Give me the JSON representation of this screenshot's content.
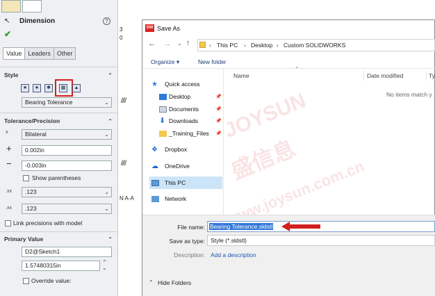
{
  "property_manager": {
    "title": "Dimension",
    "help_glyph": "?",
    "check_glyph": "✔",
    "tabs": [
      "Value",
      "Leaders",
      "Other"
    ],
    "style": {
      "header": "Style",
      "selected": "Bearing Tolerance"
    },
    "tolerance": {
      "header": "Tolerance/Precision",
      "type": "Bilateral",
      "plus_value": "0.002in",
      "minus_value": "-0.003in",
      "show_parentheses": "Show parentheses",
      "precision1": ".123",
      "precision2": ".123",
      "link_precisions": "Link precisions with model"
    },
    "primary_value": {
      "header": "Primary Value",
      "name": "D2@Sketch1",
      "value": "1.57480315in",
      "override": "Override value:"
    }
  },
  "drawing": {
    "label_a": "3",
    "label_b": "0",
    "section_label": "N A-A"
  },
  "dialog": {
    "title": "Save As",
    "app_icon_text": "SW",
    "breadcrumb": [
      "This PC",
      "Desktop",
      "Custom SOLIDWORKS"
    ],
    "toolbar": {
      "organize": "Organize ▾",
      "new_folder": "New folder"
    },
    "sidebar": [
      {
        "label": "Quick access",
        "icon": "star-icon"
      },
      {
        "label": "Desktop",
        "icon": "desktop-icon",
        "pinned": true
      },
      {
        "label": "Documents",
        "icon": "documents-icon",
        "pinned": true
      },
      {
        "label": "Downloads",
        "icon": "downloads-icon",
        "pinned": true
      },
      {
        "label": "_Training_Files",
        "icon": "folder-icon",
        "pinned": true
      },
      {
        "label": "Dropbox",
        "icon": "dropbox-icon"
      },
      {
        "label": "OneDrive",
        "icon": "onedrive-icon"
      },
      {
        "label": "This PC",
        "icon": "computer-icon",
        "selected": true
      },
      {
        "label": "Network",
        "icon": "network-icon"
      }
    ],
    "columns": {
      "name": "Name",
      "date_modified": "Date modified",
      "type": "Ty"
    },
    "empty_message": "No items match y",
    "form": {
      "file_name_label": "File name:",
      "file_name_value": "Bearing Tolerance.sldstl",
      "save_as_type_label": "Save as type:",
      "save_as_type_value": "Style (*.sldstl)",
      "description_label": "Description:",
      "description_link": "Add a description"
    },
    "hide_folders": "Hide Folders"
  },
  "watermark": {
    "line1": "JOYSUN",
    "line2": "盛信息",
    "line3": "www.joysun.com.cn"
  },
  "colors": {
    "highlight_red": "#d21f1f",
    "selection_blue": "#3478d6",
    "link_blue": "#1a56b0"
  }
}
